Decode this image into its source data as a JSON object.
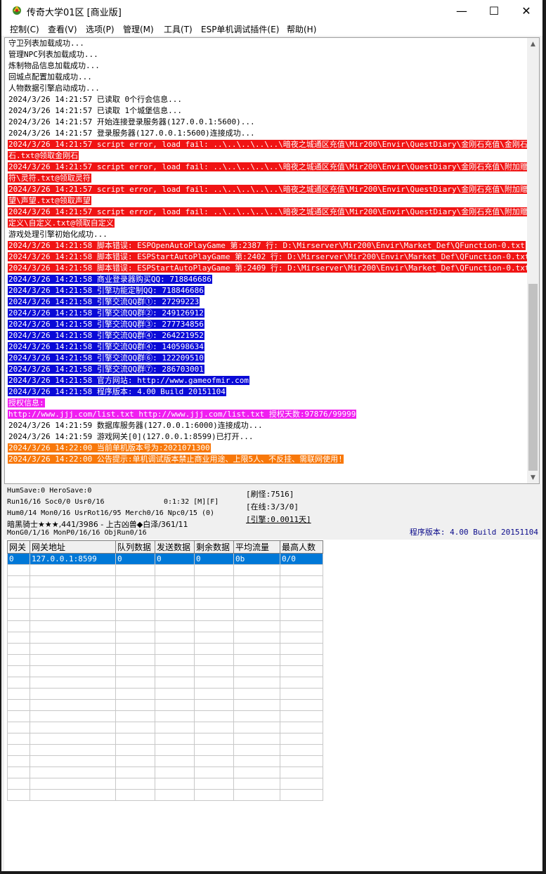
{
  "window": {
    "title": "传奇大学01区 [商业版]",
    "minimize": "—",
    "maximize": "☐",
    "close": "✕"
  },
  "menu": [
    "控制(C)",
    "查看(V)",
    "选项(P)",
    "管理(M)",
    "工具(T)",
    "ESP单机调试插件(E)",
    "帮助(H)"
  ],
  "colors": {
    "red": "#f01414",
    "blue": "#0a0ad7",
    "magenta": "#f01ef0",
    "orange": "#f8780a",
    "selection": "#0078d7"
  },
  "log_lines": [
    {
      "text": "守卫列表加载成功...",
      "style": "plain"
    },
    {
      "text": "管理NPC列表加载成功...",
      "style": "plain"
    },
    {
      "text": "炼制物品信息加载成功...",
      "style": "plain"
    },
    {
      "text": "回城点配置加载成功...",
      "style": "plain"
    },
    {
      "text": "人物数据引擎启动成功...",
      "style": "plain"
    },
    {
      "text": "2024/3/26 14:21:57 已读取 0个行会信息...",
      "style": "plain"
    },
    {
      "text": "2024/3/26 14:21:57 已读取 1个城堡信息...",
      "style": "plain"
    },
    {
      "text": "2024/3/26 14:21:57 开始连接登录服务器(127.0.0.1:5600)...",
      "style": "plain"
    },
    {
      "text": "2024/3/26 14:21:57 登录服务器(127.0.0.1:5600)连接成功...",
      "style": "plain"
    },
    {
      "text": "2024/3/26 14:21:57 script error, load fail: ..\\..\\..\\..\\..\\暗夜之城通区充值\\Mir200\\Envir\\QuestDiary\\金刚石充值\\金刚石\\金刚",
      "style": "red"
    },
    {
      "text": "石.txt@领取金刚石",
      "style": "red"
    },
    {
      "text": "2024/3/26 14:21:57 script error, load fail: ..\\..\\..\\..\\..\\暗夜之城通区充值\\Mir200\\Envir\\QuestDiary\\金刚石充值\\附加赠送\\灵",
      "style": "red"
    },
    {
      "text": "符\\灵符.txt@领取灵符",
      "style": "red"
    },
    {
      "text": "2024/3/26 14:21:57 script error, load fail: ..\\..\\..\\..\\..\\暗夜之城通区充值\\Mir200\\Envir\\QuestDiary\\金刚石充值\\附加赠送\\声",
      "style": "red"
    },
    {
      "text": "望\\声望.txt@领取声望",
      "style": "red"
    },
    {
      "text": "2024/3/26 14:21:57 script error, load fail: ..\\..\\..\\..\\..\\暗夜之城通区充值\\Mir200\\Envir\\QuestDiary\\金刚石充值\\附加赠送\\自",
      "style": "red"
    },
    {
      "text": "定义\\自定义.txt@领取自定义",
      "style": "red"
    },
    {
      "text": "游戏处理引擎初始化成功...",
      "style": "plain"
    },
    {
      "text": "2024/3/26 14:21:58 脚本错误: ESPOpenAutoPlayGame 第:2387 行: D:\\Mirserver\\Mir200\\Envir\\Market_Def\\QFunction-0.txt",
      "style": "red"
    },
    {
      "text": "2024/3/26 14:21:58 脚本错误: ESPStartAutoPlayGame 第:2402 行: D:\\Mirserver\\Mir200\\Envir\\Market_Def\\QFunction-0.txt",
      "style": "red"
    },
    {
      "text": "2024/3/26 14:21:58 脚本错误: ESPStartAutoPlayGame 第:2409 行: D:\\Mirserver\\Mir200\\Envir\\Market_Def\\QFunction-0.txt",
      "style": "red"
    },
    {
      "text": "2024/3/26 14:21:58 商业登录器购买QQ: 718846686",
      "style": "blue"
    },
    {
      "text": "2024/3/26 14:21:58 引擎功能定制QQ: 718846686",
      "style": "blue"
    },
    {
      "text": "2024/3/26 14:21:58 引擎交流QQ群①: 27299223",
      "style": "blue"
    },
    {
      "text": "2024/3/26 14:21:58 引擎交流QQ群②: 249126912",
      "style": "blue"
    },
    {
      "text": "2024/3/26 14:21:58 引擎交流QQ群③: 277734856",
      "style": "blue"
    },
    {
      "text": "2024/3/26 14:21:58 引擎交流QQ群④: 264221952",
      "style": "blue"
    },
    {
      "text": "2024/3/26 14:21:58 引擎交流QQ群④: 140598634",
      "style": "blue"
    },
    {
      "text": "2024/3/26 14:21:58 引擎交流QQ群⑥: 122209510",
      "style": "blue"
    },
    {
      "text": "2024/3/26 14:21:58 引擎交流QQ群⑦: 286703001",
      "style": "blue"
    },
    {
      "text": "2024/3/26 14:21:58 官方网站: http://www.gameofmir.com",
      "style": "blue"
    },
    {
      "text": "2024/3/26 14:21:58 程序版本: 4.00 Build 20151104",
      "style": "blue"
    },
    {
      "text": "授权信息:",
      "style": "magenta"
    },
    {
      "text": "http://www.jjj.com/list.txt http://www.jjj.com/list.txt 授权天数:97876/99999",
      "style": "magenta"
    },
    {
      "text": "2024/3/26 14:21:59 数据库服务器(127.0.0.1:6000)连接成功...",
      "style": "plain"
    },
    {
      "text": "2024/3/26 14:21:59 游戏网关[0](127.0.0.1:8599)已打开...",
      "style": "plain"
    },
    {
      "text": "2024/3/26 14:22:00 当前单机版本号为:2021071300",
      "style": "orange"
    },
    {
      "text": "2024/3/26 14:22:00 公告提示:单机调试版本禁止商业用途、上限5人、不反挂、需联网使用!",
      "style": "orange"
    }
  ],
  "status": {
    "line1": "HumSave:0 HeroSave:0",
    "line2": "Run16/16 Soc0/0 Usr0/16",
    "timer": "0:1:32 [M][F]",
    "line3": "Hum0/14 Mon0/16 UsrRot16/95 Merch0/16 Npc0/15 (0)",
    "line4": "暗黑骑士★★★,441/3986 - 上古凶兽◆白泽/361/11",
    "line5": "MonG0/1/16 MonP0/16/16 ObjRun0/16",
    "refresh": "[刷怪:7516]",
    "online": "[在线:3/3/0]",
    "engine": "[引擎:0.0011天]",
    "version": "程序版本: 4.00 Build 20151104"
  },
  "grid": {
    "columns": [
      "网关",
      "网关地址",
      "队列数据",
      "发送数据",
      "剩余数据",
      "平均流量",
      "最高人数"
    ],
    "rows": [
      [
        "0",
        "127.0.0.1:8599",
        "0",
        "0",
        "0",
        "0b",
        "0/0"
      ]
    ]
  }
}
